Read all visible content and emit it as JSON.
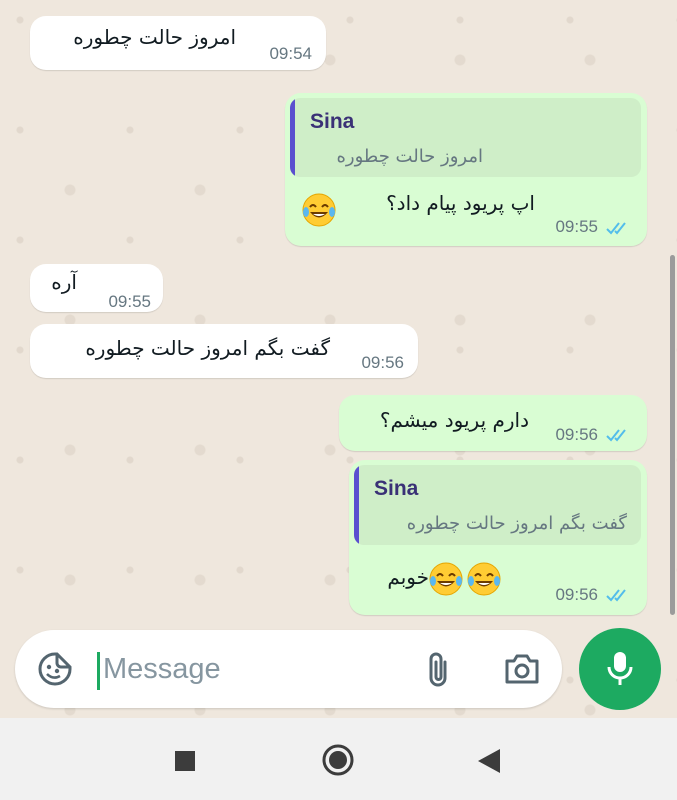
{
  "messages": [
    {
      "direction": "incoming",
      "text": "امروز حالت چطوره",
      "time": "09:54"
    },
    {
      "direction": "outgoing",
      "quote": {
        "author": "Sina",
        "text": "امروز حالت چطوره"
      },
      "text": "اپ پریود پیام داد؟",
      "emoji": "face-with-tears-of-joy",
      "time": "09:55",
      "status": "read"
    },
    {
      "direction": "incoming",
      "text": "آره",
      "time": "09:55"
    },
    {
      "direction": "incoming",
      "text": "گفت بگم امروز حالت چطوره",
      "time": "09:56"
    },
    {
      "direction": "outgoing",
      "text": "دارم پریود میشم؟",
      "time": "09:56",
      "status": "read"
    },
    {
      "direction": "outgoing",
      "quote": {
        "author": "Sina",
        "text": "گفت بگم امروز حالت چطوره"
      },
      "text": "خوبم",
      "emoji": "face-with-tears-of-joy x2",
      "time": "09:56",
      "status": "read"
    }
  ],
  "composer": {
    "placeholder": "Message",
    "icons": [
      "sticker-icon",
      "attach-icon",
      "camera-icon",
      "mic-icon"
    ]
  },
  "navbar": {
    "icons": [
      "recents-icon",
      "home-icon",
      "back-icon"
    ]
  },
  "colors": {
    "incoming_bubble": "#ffffff",
    "outgoing_bubble": "#d9fdd3",
    "read_ticks": "#53bdeb",
    "accent": "#1daa61",
    "quote_author": "#3a3176"
  }
}
